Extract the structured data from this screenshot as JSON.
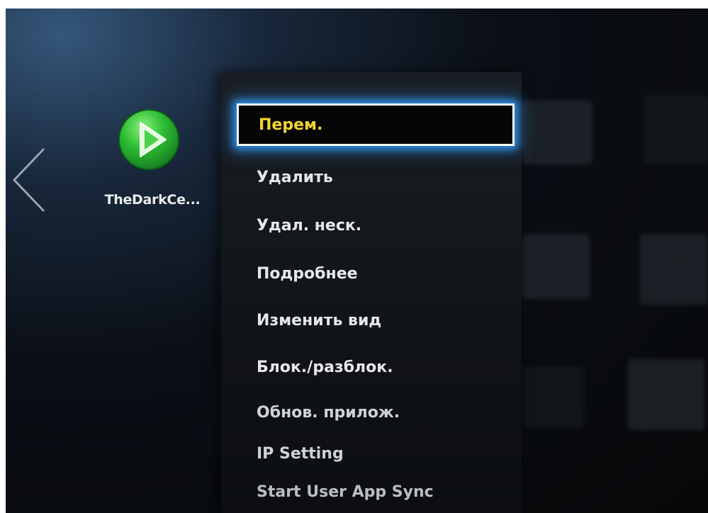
{
  "app": {
    "name": "TheDarkCe...",
    "icon": "green-play-icon",
    "icon_color": "#2fbf35"
  },
  "navigation": {
    "back_icon": "chevron-left-icon"
  },
  "context_menu": {
    "items": [
      {
        "label": "Перем.",
        "selected": true
      },
      {
        "label": "Удалить"
      },
      {
        "label": "Удал. неск."
      },
      {
        "label": "Подробнее"
      },
      {
        "label": "Изменить вид"
      },
      {
        "label": "Блок./разблок."
      },
      {
        "label": "Обнов. прилож."
      },
      {
        "label": "IP Setting"
      },
      {
        "label": "Start User App Sync"
      }
    ],
    "selection_color": "#f2d530",
    "focus_glow_color": "#2e8fe8"
  }
}
